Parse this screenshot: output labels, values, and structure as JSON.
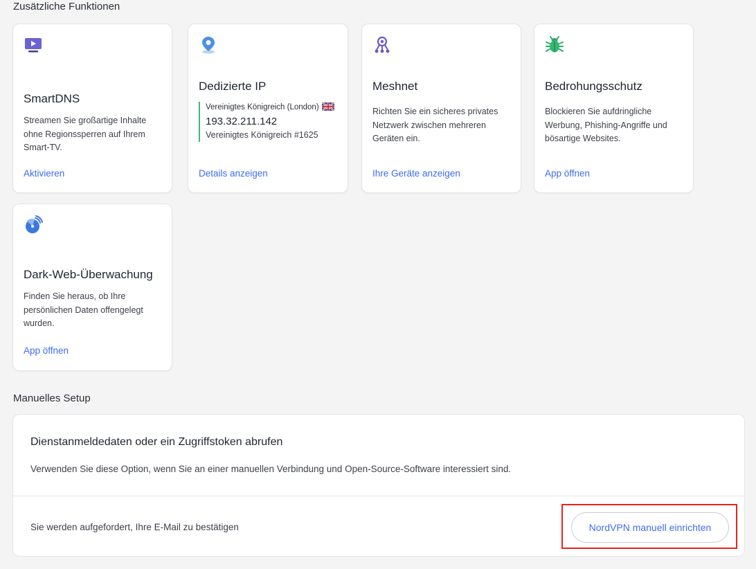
{
  "sections": {
    "features_title": "Zusätzliche Funktionen",
    "manual_title": "Manuelles Setup"
  },
  "cards": {
    "smartdns": {
      "icon": "tv-play-icon",
      "title": "SmartDNS",
      "description": "Streamen Sie großartige Inhalte ohne Regionssperren auf Ihrem Smart-TV.",
      "link": "Aktivieren"
    },
    "dedicated_ip": {
      "icon": "location-pin-icon",
      "title": "Dedizierte IP",
      "location": "Vereinigtes Königreich (London)",
      "flag": "uk-flag-icon",
      "ip": "193.32.211.142",
      "server": "Vereinigtes Königreich #1625",
      "link": "Details anzeigen"
    },
    "meshnet": {
      "icon": "meshnet-icon",
      "title": "Meshnet",
      "description": "Richten Sie ein sicheres privates Netzwerk zwischen mehreren Geräten ein.",
      "link": "Ihre Geräte anzeigen"
    },
    "threat_protection": {
      "icon": "bug-icon",
      "title": "Bedrohungsschutz",
      "description": "Blockieren Sie aufdringliche Werbung, Phishing-Angriffe und bösartige Websites.",
      "link": "App öffnen"
    },
    "dark_web": {
      "icon": "radar-icon",
      "title": "Dark-Web-Überwachung",
      "description": "Finden Sie heraus, ob Ihre persönlichen Daten offengelegt wurden.",
      "link": "App öffnen"
    }
  },
  "manual_setup": {
    "title": "Dienstanmeldedaten oder ein Zugriffstoken abrufen",
    "description": "Verwenden Sie diese Option, wenn Sie an einer manuellen Verbindung und Open-Source-Software interessiert sind.",
    "note": "Sie werden aufgefordert, Ihre E-Mail zu bestätigen",
    "button": "NordVPN manuell einrichten"
  },
  "colors": {
    "link": "#3e6cf0",
    "highlight": "#e8221f",
    "ip_bar": "#3cb878"
  }
}
